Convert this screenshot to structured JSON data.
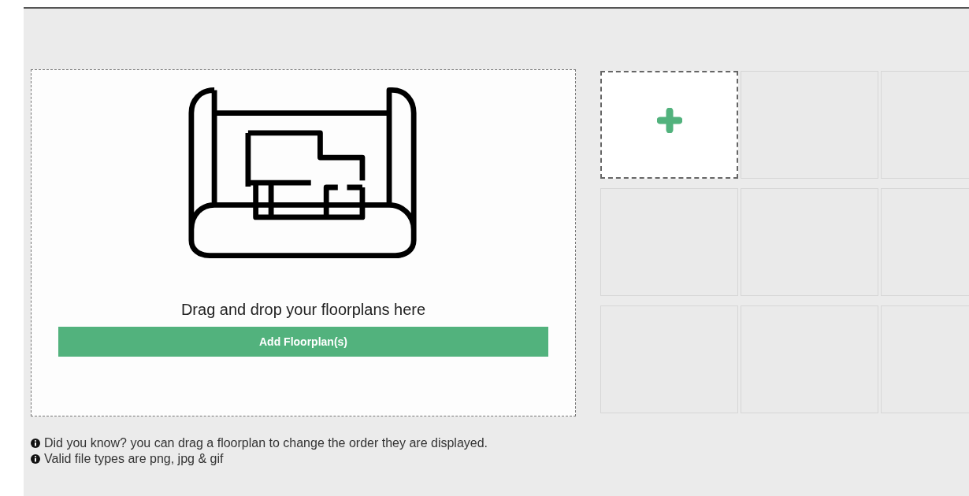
{
  "dropzone": {
    "prompt": "Drag and drop your floorplans here",
    "button": "Add Floorplan(s)"
  },
  "slots": [
    {
      "kind": "add"
    },
    {
      "kind": "empty"
    },
    {
      "kind": "empty"
    },
    {
      "kind": "empty"
    },
    {
      "kind": "empty"
    },
    {
      "kind": "empty"
    },
    {
      "kind": "empty"
    },
    {
      "kind": "empty"
    },
    {
      "kind": "empty"
    }
  ],
  "tips": [
    "Did you know? you can drag a floorplan to change the order they are displayed.",
    "Valid file types are png, jpg & gif"
  ]
}
